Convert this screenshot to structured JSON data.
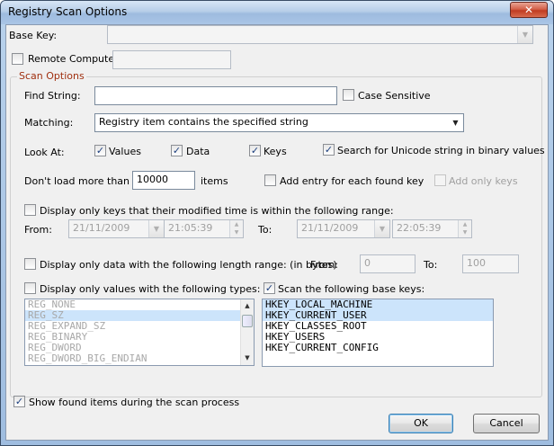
{
  "window": {
    "title": "Registry Scan Options",
    "close_label": "✕"
  },
  "base_key": {
    "label": "Base Key:",
    "value": ""
  },
  "remote_computer": {
    "label": "Remote Computer:",
    "checked": false,
    "value": ""
  },
  "scan_options": {
    "title": "Scan Options",
    "find_string": {
      "label": "Find String:",
      "value": ""
    },
    "case_sensitive": {
      "label": "Case Sensitive",
      "checked": false
    },
    "matching": {
      "label": "Matching:",
      "value": "Registry item contains the specified string"
    },
    "look_at": {
      "label": "Look At:",
      "values": {
        "label": "Values",
        "checked": true
      },
      "data": {
        "label": "Data",
        "checked": true
      },
      "keys": {
        "label": "Keys",
        "checked": true
      }
    },
    "unicode_search": {
      "label": "Search for Unicode string in binary values",
      "checked": true
    },
    "dont_load": {
      "label": "Don't load more than",
      "value": "10000",
      "suffix": "items"
    },
    "add_entry_each_key": {
      "label": "Add entry for each found key",
      "checked": false
    },
    "add_only_keys": {
      "label": "Add only keys",
      "checked": false
    }
  },
  "modified_time": {
    "label": "Display only keys that their modified time is within the following range:",
    "checked": false,
    "from_label": "From:",
    "from_date": "21/11/2009",
    "from_time": "21:05:39",
    "to_label": "To:",
    "to_date": "21/11/2009",
    "to_time": "22:05:39"
  },
  "length_range": {
    "label": "Display only data with the following length range: (in bytes)",
    "checked": false,
    "from_label": "From:",
    "from_value": "0",
    "to_label": "To:",
    "to_value": "100"
  },
  "value_types": {
    "label": "Display only values with the following types:",
    "checked": false,
    "items": [
      "REG_NONE",
      "REG_SZ",
      "REG_EXPAND_SZ",
      "REG_BINARY",
      "REG_DWORD",
      "REG_DWORD_BIG_ENDIAN"
    ],
    "selected_index": 1
  },
  "base_keys": {
    "label": "Scan the following base keys:",
    "checked": true,
    "items": [
      "HKEY_LOCAL_MACHINE",
      "HKEY_CURRENT_USER",
      "HKEY_CLASSES_ROOT",
      "HKEY_USERS",
      "HKEY_CURRENT_CONFIG"
    ],
    "selected_indices": [
      0,
      1
    ]
  },
  "show_found": {
    "label": "Show found items during the scan process",
    "checked": true
  },
  "buttons": {
    "ok": "OK",
    "cancel": "Cancel"
  },
  "glyphs": {
    "check": "✓",
    "combo_arrow": "▼",
    "spin_up": "▲",
    "spin_down": "▼",
    "scroll_up": "▲",
    "scroll_down": "▼"
  }
}
